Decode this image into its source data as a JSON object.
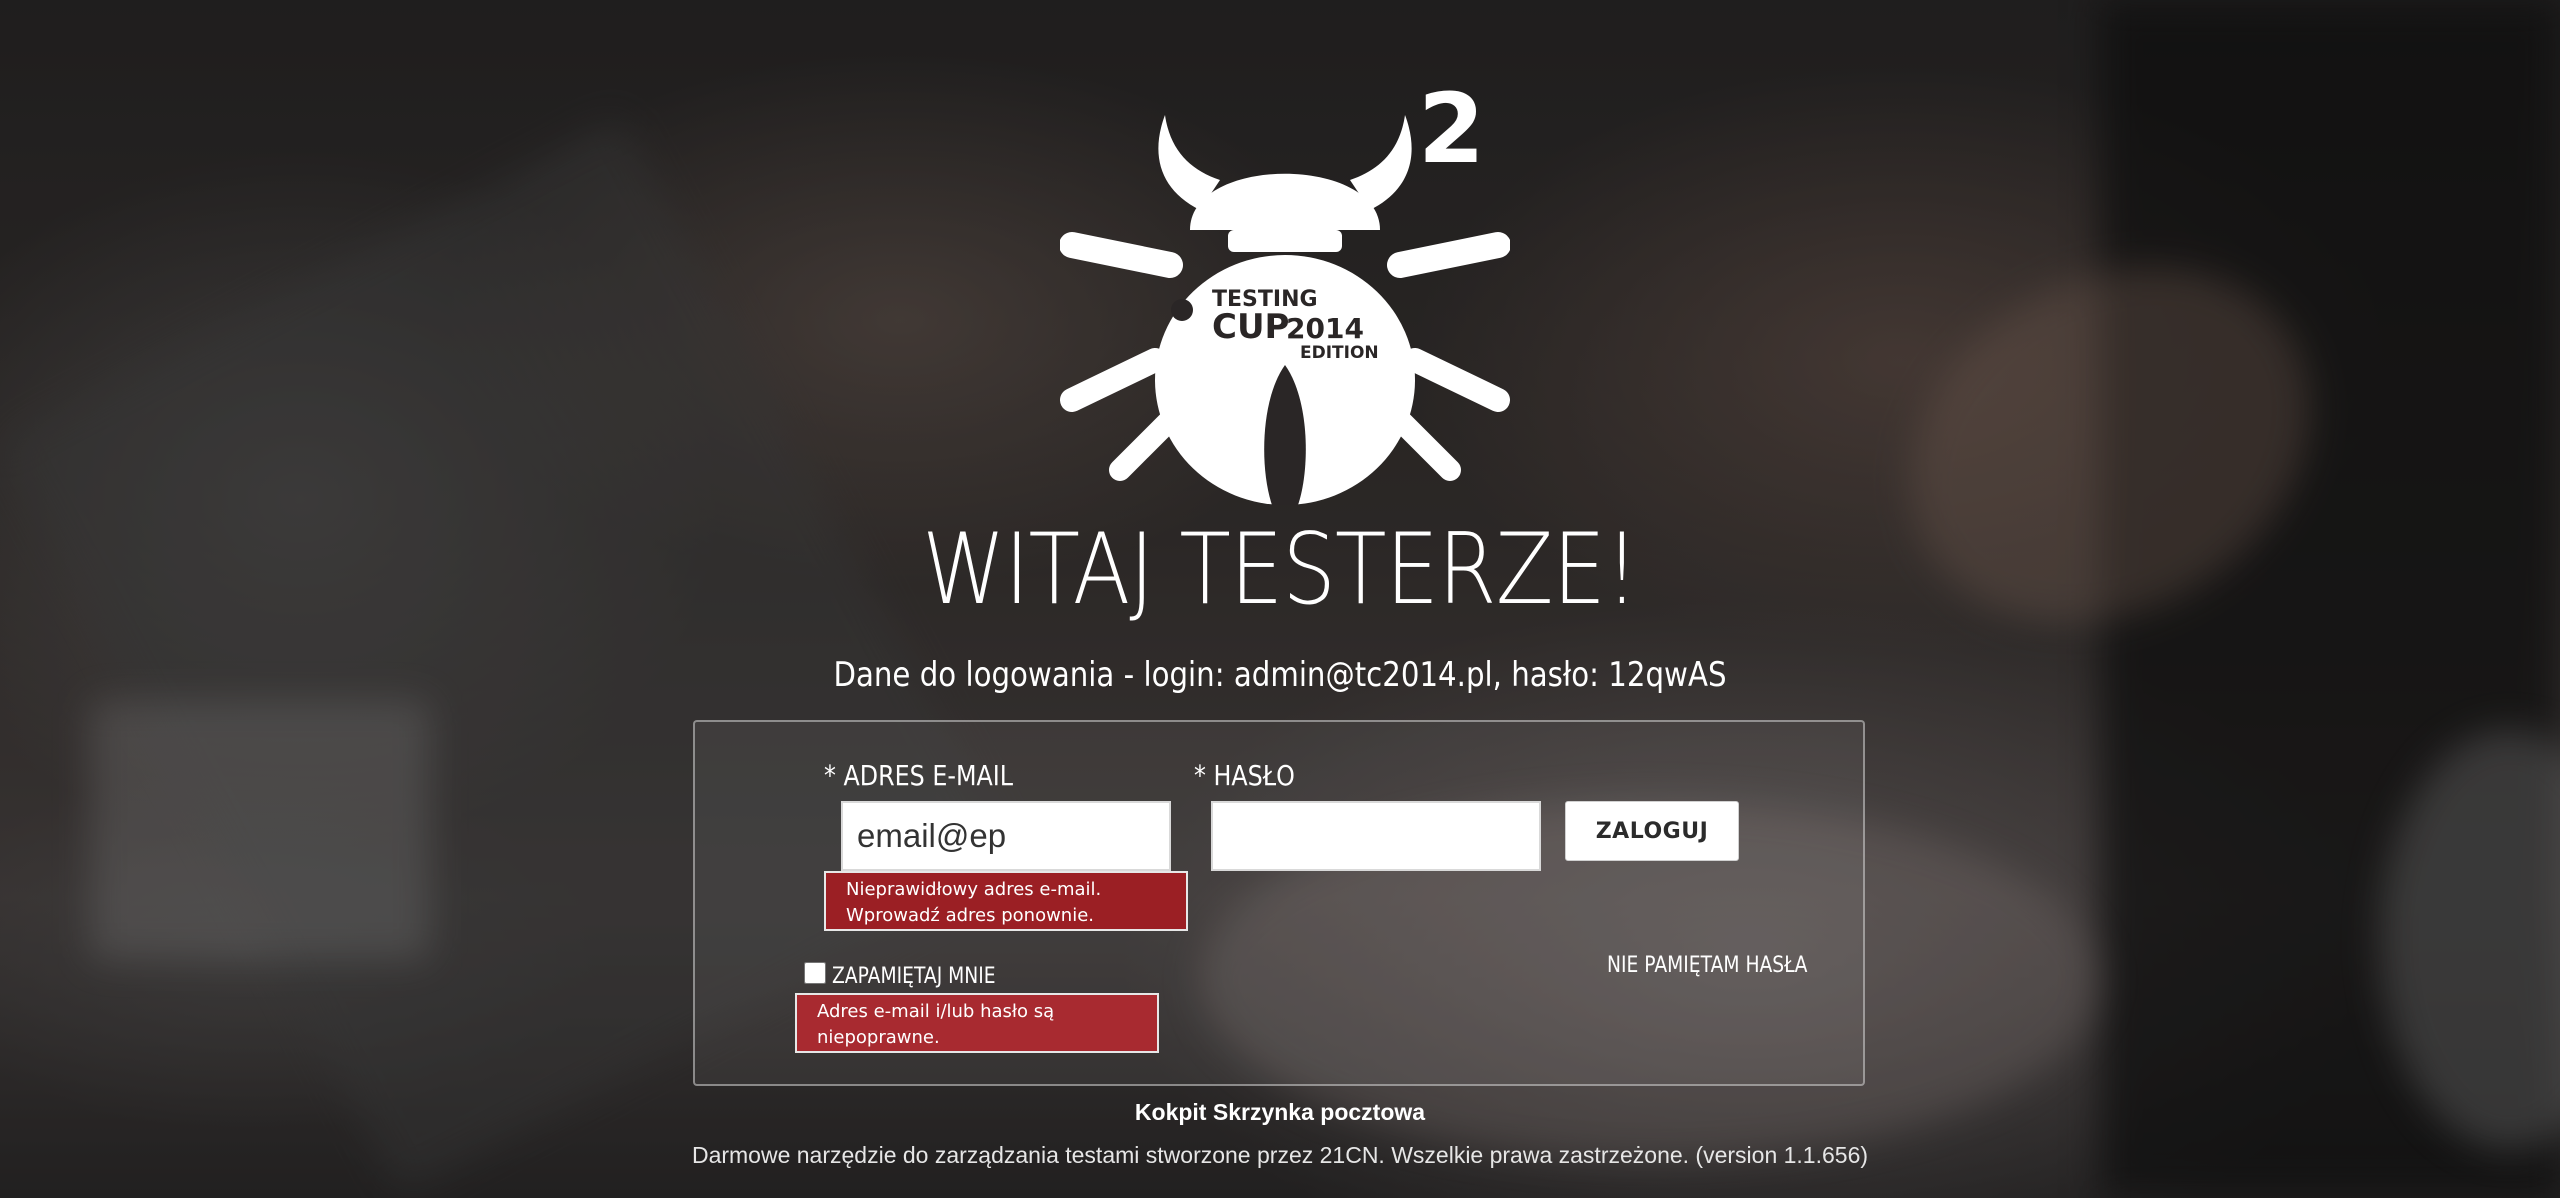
{
  "logo": {
    "superscript": "2",
    "line1": "TESTING",
    "line2": "CUP",
    "year": "2014",
    "line3": "EDITION"
  },
  "heading": "WITAJ TESTERZE!",
  "credentials_hint": "Dane do logowania - login: admin@tc2014.pl, hasło: 12qwAS",
  "form": {
    "email_label": "* ADRES E-MAIL",
    "email_value": "email@ep",
    "email_placeholder": "",
    "email_error": "Nieprawidłowy adres e-mail. Wprowadź adres ponownie.",
    "password_label": "* HASŁO",
    "password_value": "",
    "login_button": "ZALOGUJ",
    "remember_label": "ZAPAMIĘTAJ MNIE",
    "remember_checked": false,
    "forgot_link": "NIE PAMIĘTAM HASŁA",
    "auth_error": "Adres e-mail i/lub hasło są niepoprawne."
  },
  "footer": {
    "links": [
      "Kokpit",
      "Skrzynka pocztowa"
    ],
    "copyright": "Darmowe narzędzie do zarządzania testami stworzone przez 21CN. Wszelkie prawa zastrzeżone. (version 1.1.656)"
  },
  "colors": {
    "error_bg": "#9b1f24",
    "text": "#ffffff"
  }
}
